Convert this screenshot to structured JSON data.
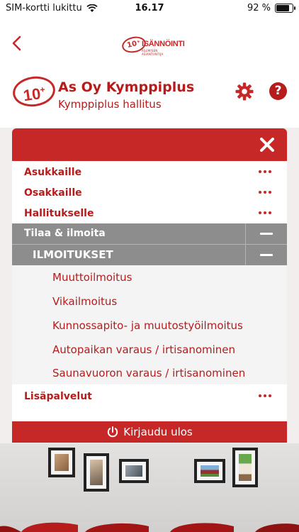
{
  "status": {
    "carrier": "SIM-kortti lukittu",
    "time": "16.17",
    "battery": "92 %",
    "battery_level": 0.92
  },
  "brand": {
    "mark": "10⁺",
    "word": "ISÄNNÖINTI",
    "tagline": "ASUMISEN ASIANTUNTIJA"
  },
  "company": {
    "name": "As Oy Kymppiplus",
    "subtitle": "Kymppiplus hallitus",
    "logo_text": "10",
    "logo_sup": "+",
    "help_label": "?"
  },
  "menu": {
    "items": [
      {
        "label": "Asukkaille"
      },
      {
        "label": "Osakkaille"
      },
      {
        "label": "Hallitukselle"
      }
    ],
    "expanded_section": "Tilaa & ilmoita",
    "expanded_subsection": "ILMOITUKSET",
    "subitems": [
      "Muuttoilmoitus",
      "Vikailmoitus",
      "Kunnossapito- ja muutostyöilmoitus",
      "Autopaikan varaus / irtisanominen",
      "Saunavuoron varaus / irtisanominen"
    ],
    "extra_item": "Lisäpalvelut"
  },
  "logout_label": "Kirjaudu ulos",
  "colors": {
    "accent": "#c62828",
    "text_accent": "#b71c1c",
    "section_gray": "#8d8d8d"
  }
}
